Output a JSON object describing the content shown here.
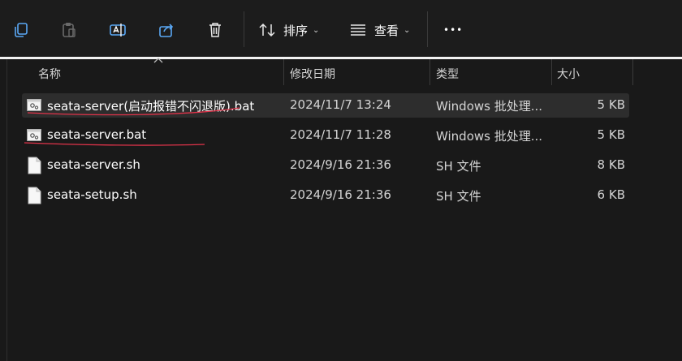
{
  "toolbar": {
    "sort_label": "排序",
    "view_label": "查看",
    "more_label": "•••"
  },
  "columns": {
    "name": "名称",
    "modified": "修改日期",
    "type": "类型",
    "size": "大小"
  },
  "files": [
    {
      "name": "seata-server(启动报错不闪退版).bat",
      "modified": "2024/11/7 13:24",
      "type": "Windows 批处理...",
      "size": "5 KB",
      "icon": "batch-file-icon"
    },
    {
      "name": "seata-server.bat",
      "modified": "2024/11/7 11:28",
      "type": "Windows 批处理...",
      "size": "5 KB",
      "icon": "batch-file-icon"
    },
    {
      "name": "seata-server.sh",
      "modified": "2024/9/16 21:36",
      "type": "SH 文件",
      "size": "8 KB",
      "icon": "document-icon"
    },
    {
      "name": "seata-setup.sh",
      "modified": "2024/9/16 21:36",
      "type": "SH 文件",
      "size": "6 KB",
      "icon": "document-icon"
    }
  ],
  "colors": {
    "annotation_red": "#e0334a",
    "icon_blue": "#5aa8f5",
    "background": "#191919"
  }
}
